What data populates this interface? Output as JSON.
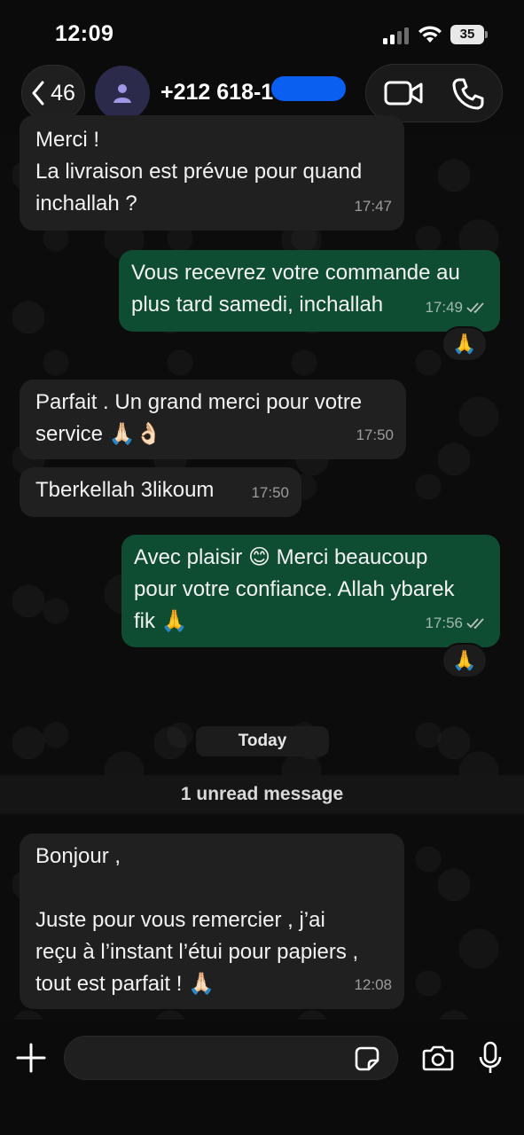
{
  "status_bar": {
    "time": "12:09",
    "battery": "35"
  },
  "header": {
    "back_count": "46",
    "contact_name": "+212 618-1"
  },
  "messages": [
    {
      "direction": "in",
      "text": "Merci !\nLa livraison est prévue pour quand\ninchallah ?",
      "time": "17:47"
    },
    {
      "direction": "out",
      "text": "Vous recevrez votre commande au\nplus tard samedi, inchallah",
      "time": "17:49",
      "reaction": "🙏"
    },
    {
      "direction": "in",
      "text": "Parfait . Un grand merci pour votre\nservice 🙏🏻👌🏻",
      "time": "17:50"
    },
    {
      "direction": "in",
      "text": "Tberkellah 3likoum",
      "time": "17:50"
    },
    {
      "direction": "out",
      "text": "Avec plaisir 😊 Merci beaucoup\npour votre confiance. Allah ybarek\nfik 🙏",
      "time": "17:56",
      "reaction": "🙏"
    },
    {
      "direction": "in",
      "text": "Bonjour ,\n\nJuste pour vous remercier , j’ai\nreçu à l’instant l’étui pour papiers ,\ntout est parfait ! 🙏🏻",
      "time": "12:08"
    }
  ],
  "date_divider": "Today",
  "unread_banner": "1 unread message",
  "composer": {
    "placeholder": ""
  },
  "colors": {
    "outgoing_bubble": "#0f4d33",
    "incoming_bubble": "#202020",
    "redaction": "#0a5ef0"
  },
  "icons": [
    "back-chevron-icon",
    "person-icon",
    "video-call-icon",
    "phone-icon",
    "read-ticks-icon",
    "plus-icon",
    "sticker-icon",
    "camera-icon",
    "microphone-icon"
  ]
}
